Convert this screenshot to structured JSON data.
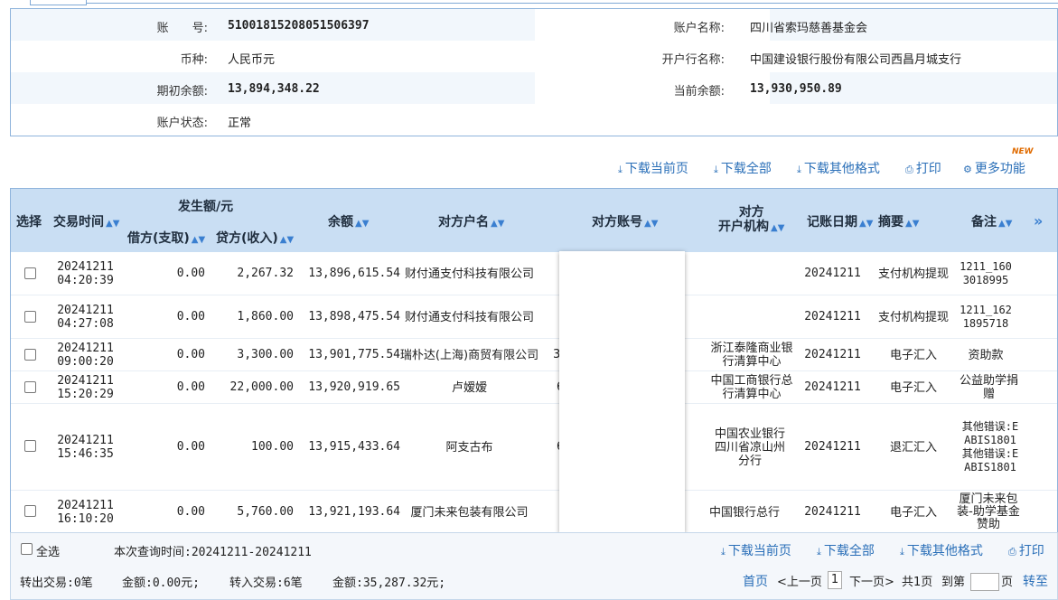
{
  "account": {
    "number_label": "账　　号:",
    "number": "51001815208051506397",
    "name_label": "账户名称:",
    "name": "四川省索玛慈善基金会",
    "currency_label": "币种:",
    "currency": "人民币元",
    "bank_label": "开户行名称:",
    "bank": "中国建设银行股份有限公司西昌月城支行",
    "opening_balance_label": "期初余额:",
    "opening_balance": "13,894,348.22",
    "current_balance_label": "当前余额:",
    "current_balance": "13,930,950.89",
    "status_label": "账户状态:",
    "status": "正常"
  },
  "toolbar": {
    "download_current": "下载当前页",
    "download_all": "下载全部",
    "download_other": "下载其他格式",
    "print": "打印",
    "more": "更多功能",
    "new_badge": "NEW"
  },
  "table": {
    "headers": {
      "select": "选择",
      "time": "交易时间",
      "amount_group": "发生额/元",
      "debit": "借方(支取)",
      "credit": "贷方(收入)",
      "balance": "余额",
      "counterparty": "对方户名",
      "counter_account": "对方账号",
      "counter_bank_1": "对方",
      "counter_bank_2": "开户机构",
      "date": "记账日期",
      "summary": "摘要",
      "remark": "备注"
    },
    "rows": [
      {
        "time1": "20241211",
        "time2": "04:20:39",
        "debit": "0.00",
        "credit": "2,267.32",
        "balance": "13,896,615.54",
        "counterparty": "财付通支付科技有限公司",
        "acct_frag": "",
        "bank": "",
        "date": "20241211",
        "summary": "支付机构提现",
        "remark": "1211_1603018995"
      },
      {
        "time1": "20241211",
        "time2": "04:27:08",
        "debit": "0.00",
        "credit": "1,860.00",
        "balance": "13,898,475.54",
        "counterparty": "财付通支付科技有限公司",
        "acct_frag": "",
        "bank": "",
        "date": "20241211",
        "summary": "支付机构提现",
        "remark": "1211_1621895718"
      },
      {
        "time1": "20241211",
        "time2": "09:00:20",
        "debit": "0.00",
        "credit": "3,300.00",
        "balance": "13,901,775.54",
        "counterparty": "瑞朴达(上海)商贸有限公司",
        "acct_frag": "3",
        "bank": "浙江泰隆商业银行清算中心",
        "date": "20241211",
        "summary": "电子汇入",
        "remark": "资助款"
      },
      {
        "time1": "20241211",
        "time2": "15:20:29",
        "debit": "0.00",
        "credit": "22,000.00",
        "balance": "13,920,919.65",
        "counterparty": "卢嫒嫒",
        "acct_frag": "6",
        "bank": "中国工商银行总行清算中心",
        "date": "20241211",
        "summary": "电子汇入",
        "remark": "公益助学捐赠"
      },
      {
        "time1": "20241211",
        "time2": "15:46:35",
        "debit": "0.00",
        "credit": "100.00",
        "balance": "13,915,433.64",
        "counterparty": "阿支古布",
        "acct_frag": "6",
        "bank": "中国农业银行四川省凉山州分行",
        "date": "20241211",
        "summary": "退汇汇入",
        "remark": "其他错误:EABIS1801其他错误:EABIS1801"
      },
      {
        "time1": "20241211",
        "time2": "16:10:20",
        "debit": "0.00",
        "credit": "5,760.00",
        "balance": "13,921,193.64",
        "counterparty": "厦门未来包装有限公司",
        "acct_frag": "",
        "bank": "中国银行总行",
        "date": "20241211",
        "summary": "电子汇入",
        "remark": "厦门未来包装-助学基金赞助"
      }
    ]
  },
  "footer": {
    "select_all": "全选",
    "query_time": "本次查询时间:20241211-20241211",
    "out_trans": "转出交易:0笔",
    "out_amount": "金额:0.00元;",
    "in_trans": "转入交易:6笔",
    "in_amount": "金额:35,287.32元;",
    "first": "首页",
    "prev": "<上一页",
    "page": "1",
    "next": "下一页>",
    "total": "共1页",
    "goto": "到第",
    "page_unit": "页",
    "go": "转至",
    "download_current": "下载当前页",
    "download_all": "下载全部",
    "download_other": "下载其他格式",
    "print": "打印"
  }
}
